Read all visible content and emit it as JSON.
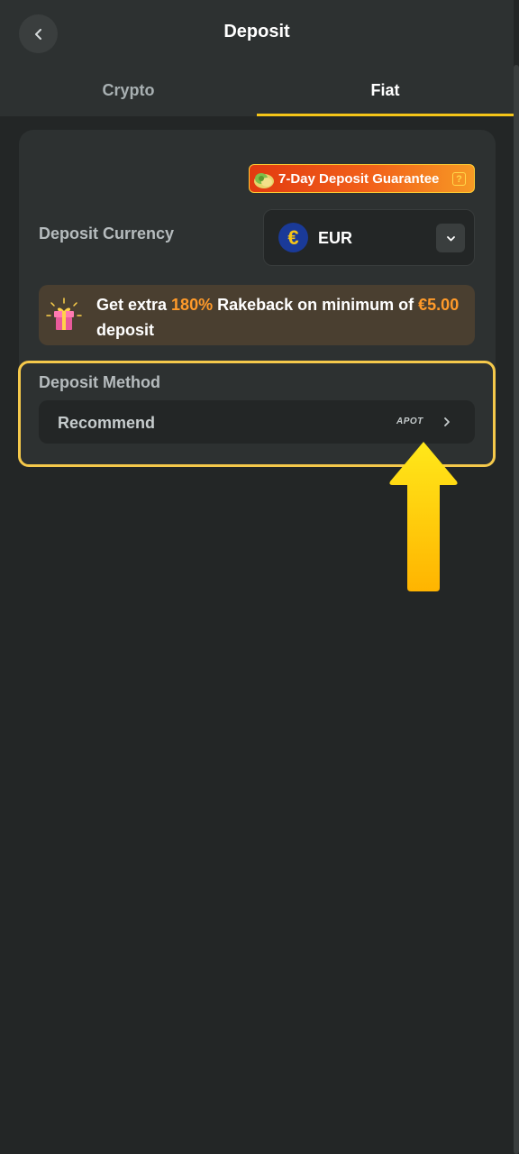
{
  "header": {
    "title": "Deposit"
  },
  "tabs": [
    {
      "label": "Crypto",
      "active": false
    },
    {
      "label": "Fiat",
      "active": true
    }
  ],
  "guarantee": {
    "label": "7-Day Deposit Guarantee",
    "help": "?"
  },
  "currency": {
    "label": "Deposit Currency",
    "symbol": "€",
    "value": "EUR"
  },
  "promo": {
    "prefix": "Get extra ",
    "percent": "180%",
    "middle": " Rakeback on minimum of ",
    "amount": "€5.00",
    "suffix": " deposit"
  },
  "deposit_method": {
    "label": "Deposit Method",
    "option": "Recommend",
    "provider_logo": "APOT"
  },
  "colors": {
    "background": "#232626",
    "panel": "#2d3131",
    "accent": "#f5c518",
    "highlight": "#ff9a2a"
  },
  "icons": [
    "back-arrow-icon",
    "coins-icon",
    "help-icon",
    "euro-icon",
    "chevron-down-icon",
    "gift-icon",
    "chevron-right-icon",
    "up-arrow-icon"
  ]
}
